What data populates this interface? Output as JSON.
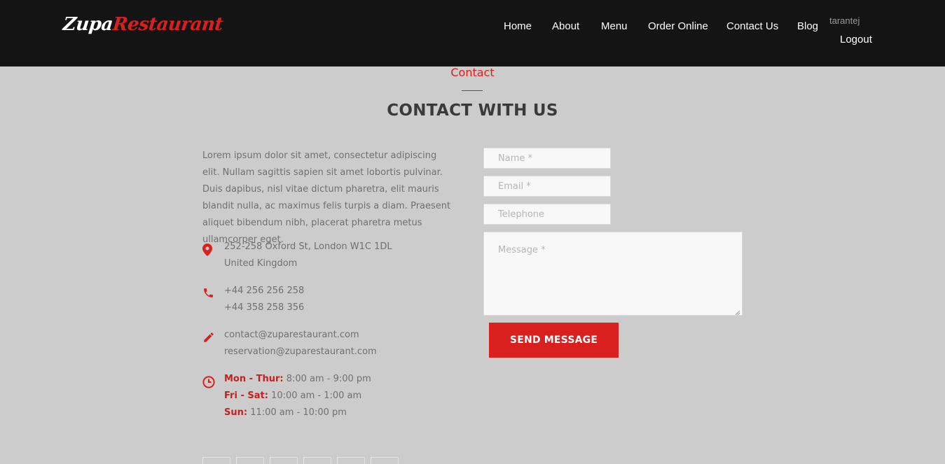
{
  "brand": {
    "logo_part1": "Zupa",
    "logo_part2": "Restaurant",
    "accent_color": "#d9201f"
  },
  "nav": {
    "items": [
      {
        "label": "Home"
      },
      {
        "label": "About"
      },
      {
        "label": "Menu"
      },
      {
        "label": "Order Online"
      },
      {
        "label": "Contact Us"
      },
      {
        "label": "Blog"
      }
    ],
    "user_name": "tarantej",
    "logout_label": "Logout"
  },
  "section": {
    "kicker": "Contact",
    "title": "CONTACT WITH US"
  },
  "intro_text": "Lorem ipsum dolor sit amet, consectetur adipiscing elit. Nullam sagittis sapien sit amet lobortis pulvinar. Duis dapibus, nisl vitae dictum pharetra, elit mauris blandit nulla, ac maximus felis turpis a diam. Praesent aliquet bibendum nibh, placerat pharetra metus ullamcorper eget.",
  "contact": {
    "address": {
      "icon": "map-pin-icon",
      "line1": "252-258 Oxford St, London W1C 1DL",
      "line2": "United Kingdom"
    },
    "phone": {
      "icon": "phone-icon",
      "line1": "+44 256 256 258",
      "line2": "+44 358 258 356"
    },
    "email": {
      "icon": "pencil-icon",
      "line1": "contact@zuparestaurant.com",
      "line2": "reservation@zuparestaurant.com"
    },
    "hours": {
      "icon": "clock-icon",
      "rows": [
        {
          "day": "Mon - Thur:",
          "time": " 8:00 am - 9:00 pm"
        },
        {
          "day": "Fri - Sat:",
          "time": " 10:00 am - 1:00 am"
        },
        {
          "day": "Sun:",
          "time": " 11:00 am - 10:00 pm"
        }
      ]
    }
  },
  "form": {
    "name_placeholder": "Name *",
    "email_placeholder": "Email *",
    "telephone_placeholder": "Telephone",
    "message_placeholder": "Message *",
    "submit_label": "SEND MESSAGE"
  }
}
